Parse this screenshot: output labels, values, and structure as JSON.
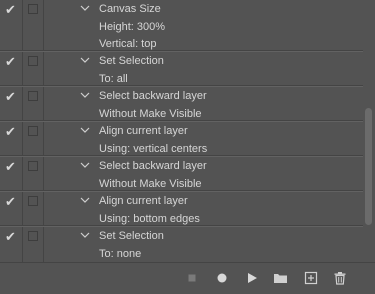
{
  "actions": [
    {
      "title": "Canvas Size",
      "details": [
        "Height: 300%",
        "Vertical: top"
      ],
      "checked": true
    },
    {
      "title": "Set Selection",
      "details": [
        "To: all"
      ],
      "checked": true
    },
    {
      "title": "Select backward layer",
      "details": [
        "Without Make Visible"
      ],
      "checked": true
    },
    {
      "title": "Align current layer",
      "details": [
        "Using: vertical centers"
      ],
      "checked": true
    },
    {
      "title": "Select backward layer",
      "details": [
        "Without Make Visible"
      ],
      "checked": true
    },
    {
      "title": "Align current layer",
      "details": [
        "Using: bottom edges"
      ],
      "checked": true
    },
    {
      "title": "Set Selection",
      "details": [
        "To: none"
      ],
      "checked": true
    }
  ],
  "toolbar": {
    "stop": "stop-icon",
    "record": "record-icon",
    "play": "play-icon",
    "folder": "folder-icon",
    "new": "new-action-icon",
    "delete": "trash-icon"
  },
  "colors": {
    "panel": "#535353",
    "text": "#d6d6d6",
    "divider": "#444444"
  }
}
